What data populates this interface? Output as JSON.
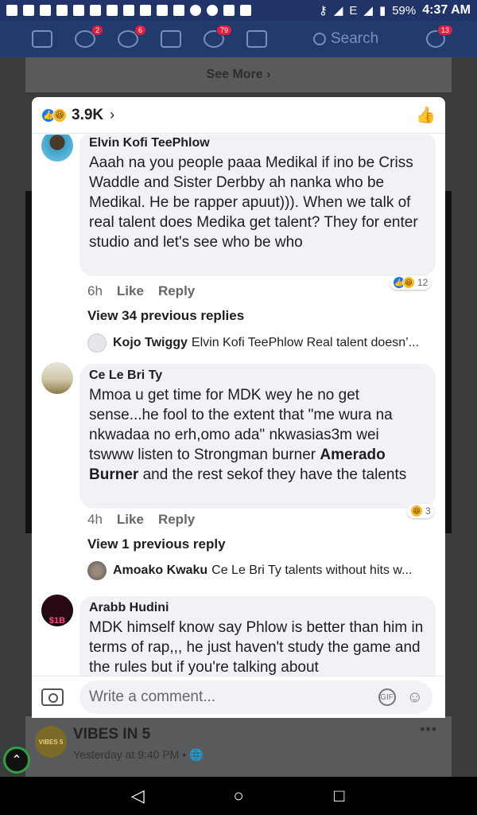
{
  "status_bar": {
    "battery": "59%",
    "network": "E",
    "time": "4:37 AM"
  },
  "nav": {
    "friend_requests_badge": "2",
    "groups_badge": "6",
    "notifications_badge": "79",
    "search_placeholder": "Search",
    "messages_badge": "13"
  },
  "feed": {
    "see_more": "See More ›",
    "post": {
      "page_logo": "VIBES 5",
      "page_name": "VIBES IN 5",
      "meta": "Yesterday at 9:40 PM • 🌐"
    }
  },
  "modal": {
    "reaction_count": "3.9K",
    "comments": [
      {
        "author": "Elvin Kofi TeePhlow",
        "text": "Aaah na you people paaa Medikal if ino be Criss Waddle and Sister Derbby ah nanka who be Medikal. He be rapper apuut))). When we talk of real talent does Medika get talent? They for enter studio and let's see who be who",
        "time": "6h",
        "like": "Like",
        "reply": "Reply",
        "reaction_count": "12",
        "view_previous": "View 34 previous replies",
        "latest_reply": {
          "author": "Kojo Twiggy",
          "text": "Elvin Kofi TeePhlow  Real talent doesn’..."
        }
      },
      {
        "author": "Ce Le Bri Ty",
        "text_before": "Mmoa u get time for MDK wey he no get sense...he fool to the extent that \"me wura na nkwadaa no erh,omo ada\" nkwasias3m wei tswww listen to Strongman burner ",
        "mention": "Amerado Burner",
        "text_after": " and the rest sekof they have the talents",
        "time": "4h",
        "like": "Like",
        "reply": "Reply",
        "reaction_count": "3",
        "view_previous": "View 1 previous reply",
        "latest_reply": {
          "author": "Amoako Kwaku",
          "text": "Ce Le Bri Ty talents without hits w..."
        }
      },
      {
        "author": "Arabb Hudini",
        "avatar_text": "$1B",
        "text": "MDK himself know say Phlow is better than him in terms of rap,,, he just haven't study the game and the rules but if you're talking about"
      }
    ],
    "composer": {
      "placeholder": "Write a comment...",
      "gif": "GIF"
    }
  },
  "colors": {
    "fb_blue": "#213469",
    "like_blue": "#1877f2",
    "haha_yellow": "#f7b928",
    "bubble_bg": "#f0f2f5",
    "meta_grey": "#65676b"
  }
}
